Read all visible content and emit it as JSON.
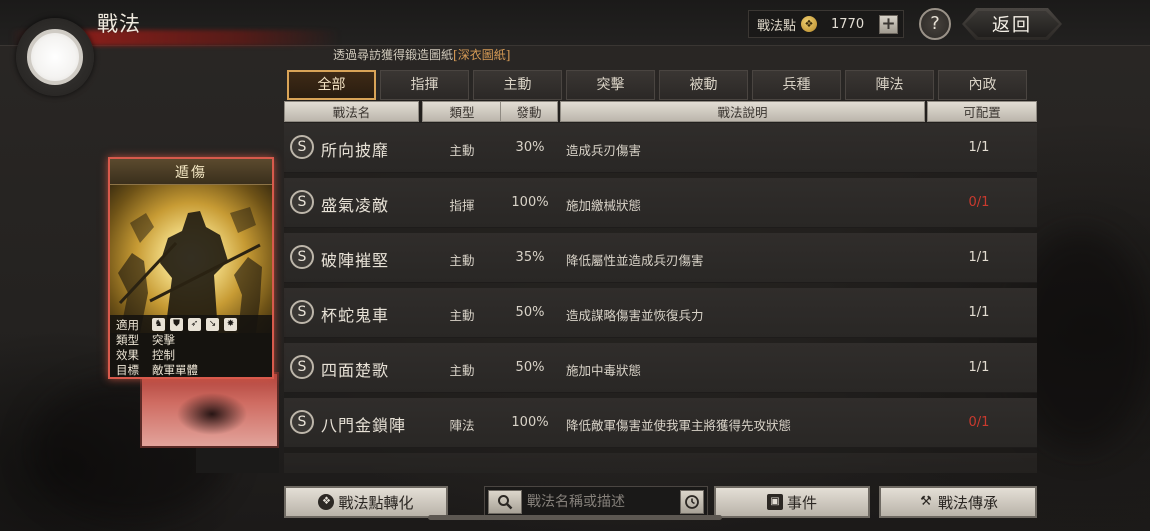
{
  "header": {
    "title": "戰法",
    "points_label": "戰法點",
    "points_value": "1770",
    "plus_label": "+",
    "help_label": "?",
    "back_label": "返回"
  },
  "source_note": {
    "prefix": "透過尋訪獲得鍛造圖紙",
    "link": "[深衣圖紙]"
  },
  "tabs": [
    {
      "label": "全部",
      "active": true
    },
    {
      "label": "指揮",
      "active": false
    },
    {
      "label": "主動",
      "active": false
    },
    {
      "label": "突擊",
      "active": false
    },
    {
      "label": "被動",
      "active": false
    },
    {
      "label": "兵種",
      "active": false
    },
    {
      "label": "陣法",
      "active": false
    },
    {
      "label": "內政",
      "active": false
    }
  ],
  "columns": {
    "name": "戰法名",
    "type": "類型",
    "rate": "發動",
    "desc": "戰法說明",
    "cfg": "可配置"
  },
  "rows": [
    {
      "grade": "S",
      "name": "所向披靡",
      "type": "主動",
      "rate": "30%",
      "desc": "造成兵刃傷害",
      "cfg": "1/1",
      "cfg_color": "#e3ddd2"
    },
    {
      "grade": "S",
      "name": "盛氣凌敵",
      "type": "指揮",
      "rate": "100%",
      "desc": "施加繳械狀態",
      "cfg": "0/1",
      "cfg_color": "#c93a2e"
    },
    {
      "grade": "S",
      "name": "破陣摧堅",
      "type": "主動",
      "rate": "35%",
      "desc": "降低屬性並造成兵刃傷害",
      "cfg": "1/1",
      "cfg_color": "#e3ddd2"
    },
    {
      "grade": "S",
      "name": "杯蛇鬼車",
      "type": "主動",
      "rate": "50%",
      "desc": "造成謀略傷害並恢復兵力",
      "cfg": "1/1",
      "cfg_color": "#e3ddd2"
    },
    {
      "grade": "S",
      "name": "四面楚歌",
      "type": "主動",
      "rate": "50%",
      "desc": "施加中毒狀態",
      "cfg": "1/1",
      "cfg_color": "#e3ddd2"
    },
    {
      "grade": "S",
      "name": "八門金鎖陣",
      "type": "陣法",
      "rate": "100%",
      "desc": "降低敵軍傷害並使我軍主將獲得先攻狀態",
      "cfg": "0/1",
      "cfg_color": "#c93a2e"
    }
  ],
  "card": {
    "title": "遁傷",
    "info": [
      {
        "key": "適用",
        "value": ""
      },
      {
        "key": "類型",
        "value": "突擊"
      },
      {
        "key": "效果",
        "value": "控制"
      },
      {
        "key": "目標",
        "value": "敵軍單體"
      }
    ],
    "unit_icons": [
      "cavalry-icon",
      "shield-icon",
      "bow-icon",
      "spear-icon",
      "siege-icon"
    ]
  },
  "bottom": {
    "convert_label": "戰法點轉化",
    "search_placeholder": "戰法名稱或描述",
    "event_label": "事件",
    "inherit_label": "戰法傳承"
  },
  "colors": {
    "accent_gold": "#d9a458",
    "red_cfg": "#c93a2e",
    "card_glow": "#d85a4c"
  }
}
